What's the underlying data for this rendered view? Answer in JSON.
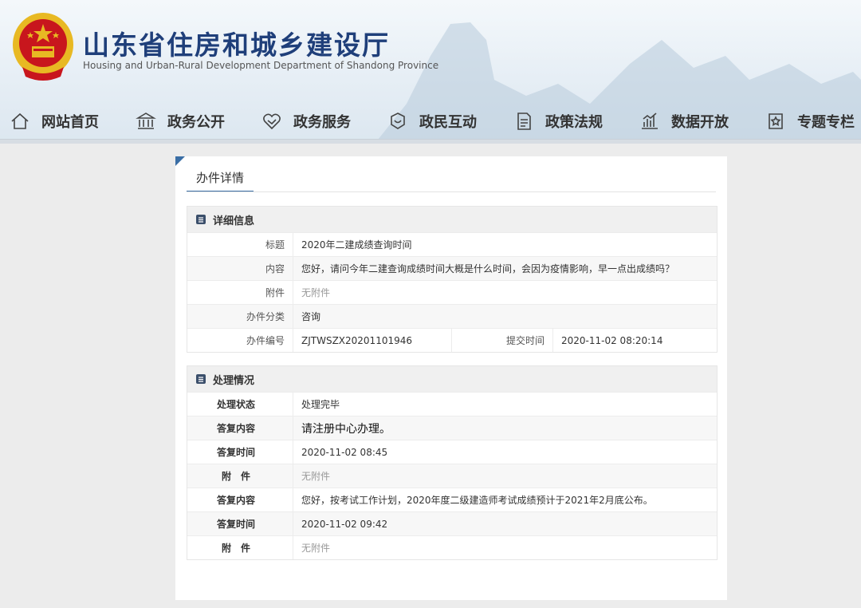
{
  "site": {
    "title": "山东省住房和城乡建设厅",
    "subtitle": "Housing and Urban-Rural Development Department of Shandong Province"
  },
  "nav": [
    {
      "label": "网站首页",
      "icon": "home-icon"
    },
    {
      "label": "政务公开",
      "icon": "government-building-icon"
    },
    {
      "label": "政务服务",
      "icon": "service-heart-icon"
    },
    {
      "label": "政民互动",
      "icon": "interaction-icon"
    },
    {
      "label": "政策法规",
      "icon": "document-icon"
    },
    {
      "label": "数据开放",
      "icon": "data-chart-icon"
    },
    {
      "label": "专题专栏",
      "icon": "topic-icon"
    }
  ],
  "panel": {
    "tab": "办件详情"
  },
  "detail": {
    "heading": "详细信息",
    "title_label": "标题",
    "title_value": "2020年二建成绩查询时间",
    "content_label": "内容",
    "content_value": "您好，请问今年二建查询成绩时间大概是什么时间，会因为疫情影响，早一点出成绩吗？",
    "attach_label": "附件",
    "attach_value": "无附件",
    "category_label": "办件分类",
    "category_value": "咨询",
    "number_label": "办件编号",
    "number_value": "ZJTWSZX20201101946",
    "submit_label": "提交时间",
    "submit_value": "2020-11-02 08:20:14"
  },
  "process": {
    "heading": "处理情况",
    "status_label": "处理状态",
    "status_value": "处理完毕",
    "reply1_label": "答复内容",
    "reply1_value": "请注册中心办理。",
    "time1_label": "答复时间",
    "time1_value": "2020-11-02 08:45",
    "attach1_label": "附　件",
    "attach1_value": "无附件",
    "reply2_label": "答复内容",
    "reply2_value": "您好，按考试工作计划，2020年度二级建造师考试成绩预计于2021年2月底公布。",
    "time2_label": "答复时间",
    "time2_value": "2020-11-02 09:42",
    "attach2_label": "附　件",
    "attach2_value": "无附件"
  },
  "colors": {
    "title": "#1f3f7a",
    "accent": "#3a6ea5",
    "emblem_red": "#c8161d",
    "emblem_gold": "#e8b923"
  }
}
